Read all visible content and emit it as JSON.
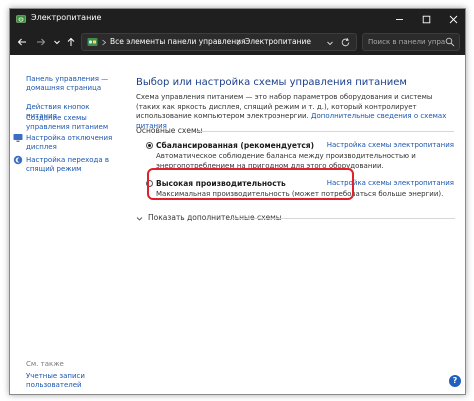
{
  "window": {
    "title": "Электропитание"
  },
  "address": {
    "crumbs": [
      "Все элементы панели управления",
      "Электропитание"
    ]
  },
  "search": {
    "placeholder": "Поиск в панели упра..."
  },
  "sidebar": {
    "links": [
      "Панель управления — домашняя страница",
      "Действия кнопок питания",
      "Создание схемы управления питанием",
      "Настройка отключения дисплея",
      "Настройка перехода в спящий режим"
    ],
    "see_also": "См. также",
    "bottom_link": "Учетные записи пользователей"
  },
  "main": {
    "title": "Выбор или настройка схемы управления питанием",
    "desc_text": "Схема управления питанием — это набор параметров оборудования и системы (таких как яркость дисплея, спящий режим и т. д.), который контролирует использование компьютером электроэнергии.",
    "desc_link": "Дополнительные сведения о схемах питания",
    "section_label": "Основные схемы",
    "plans": [
      {
        "name": "Сбалансированная (рекомендуется)",
        "link": "Настройка схемы электропитания",
        "desc": "Автоматическое соблюдение баланса между производительностью и энергопотреблением на пригодном для этого оборудовании.",
        "selected": true
      },
      {
        "name": "Высокая производительность",
        "link": "Настройка схемы электропитания",
        "desc": "Максимальная производительность (может потребоваться больше энергии).",
        "selected": false
      }
    ],
    "more_label": "Показать дополнительные схемы"
  },
  "colors": {
    "highlight": "#e0202a",
    "link": "#1a56b0",
    "title": "#1a3f8c"
  }
}
